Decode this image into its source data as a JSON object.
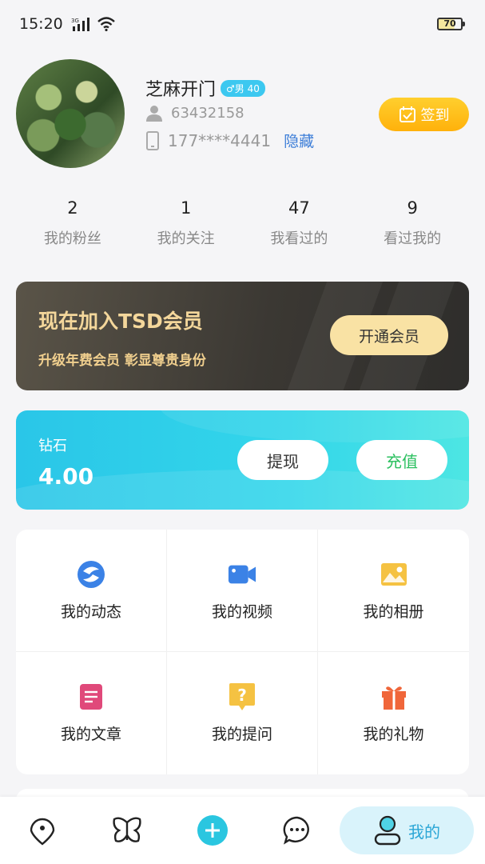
{
  "status": {
    "time": "15:20",
    "network": "3G",
    "battery": "70"
  },
  "profile": {
    "name": "芝麻开门",
    "gender_badge": "♂男 40",
    "user_id": "63432158",
    "phone": "177****4441",
    "hide_label": "隐藏",
    "checkin_label": "签到"
  },
  "stats": [
    {
      "num": "2",
      "label": "我的粉丝"
    },
    {
      "num": "1",
      "label": "我的关注"
    },
    {
      "num": "47",
      "label": "我看过的"
    },
    {
      "num": "9",
      "label": "看过我的"
    }
  ],
  "vip": {
    "title": "现在加入TSD会员",
    "subtitle": "升级年费会员 彰显尊贵身份",
    "button": "开通会员"
  },
  "wallet": {
    "label": "钻石",
    "value": "4.00",
    "withdraw": "提现",
    "recharge": "充值"
  },
  "grid": [
    {
      "label": "我的动态",
      "icon": "moments-icon",
      "color": "#3b82e6"
    },
    {
      "label": "我的视频",
      "icon": "video-camera-icon",
      "color": "#3b82e6"
    },
    {
      "label": "我的相册",
      "icon": "photo-album-icon",
      "color": "#f5c242"
    },
    {
      "label": "我的文章",
      "icon": "article-icon",
      "color": "#e0497a"
    },
    {
      "label": "我的提问",
      "icon": "question-icon",
      "color": "#f5c242"
    },
    {
      "label": "我的礼物",
      "icon": "gift-icon",
      "color": "#f0663a"
    }
  ],
  "tabbar": {
    "me_label": "我的",
    "accent": "#2aa6d6"
  }
}
